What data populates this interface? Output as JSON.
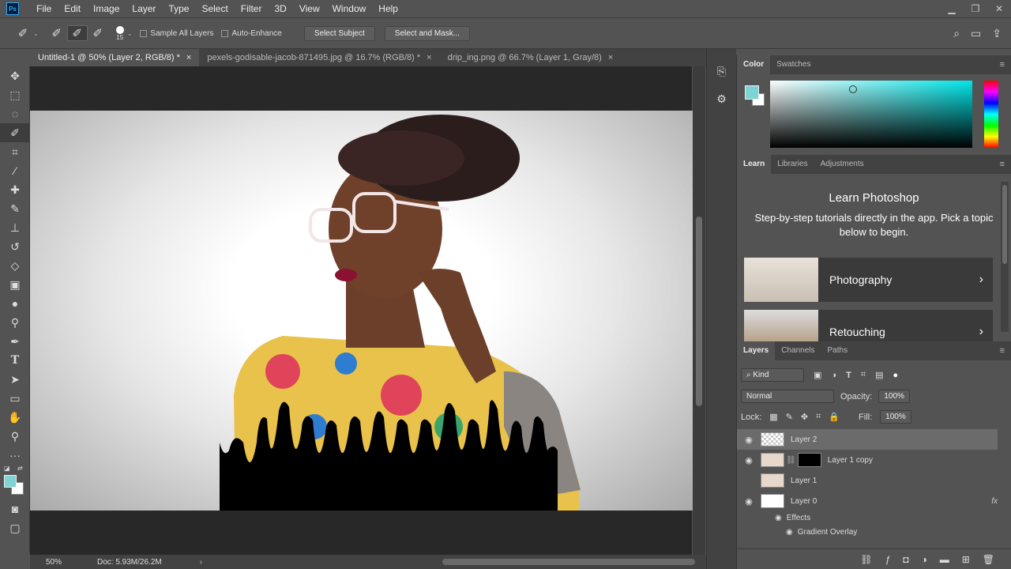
{
  "menu": {
    "logo": "Ps",
    "items": [
      "File",
      "Edit",
      "Image",
      "Layer",
      "Type",
      "Select",
      "Filter",
      "3D",
      "View",
      "Window",
      "Help"
    ]
  },
  "options": {
    "brush_size": "15",
    "sample_all_layers": "Sample All Layers",
    "auto_enhance": "Auto-Enhance",
    "select_subject": "Select Subject",
    "select_mask": "Select and Mask..."
  },
  "tabs": [
    {
      "label": "Untitled-1 @ 50% (Layer 2, RGB/8) *",
      "close": "×"
    },
    {
      "label": "pexels-godisable-jacob-871495.jpg @ 16.7% (RGB/8) *",
      "close": "×"
    },
    {
      "label": "drip_ing.png @ 66.7% (Layer 1, Gray/8)",
      "close": "×"
    }
  ],
  "status": {
    "zoom": "50%",
    "doc": "Doc: 5.93M/26.2M"
  },
  "color_panel": {
    "tabs": [
      "Color",
      "Swatches"
    ],
    "foreground": "#7fd3d6",
    "background": "#ffffff",
    "hue": "#00e5e8"
  },
  "learn_panel": {
    "tabs": [
      "Learn",
      "Libraries",
      "Adjustments"
    ],
    "title": "Learn Photoshop",
    "description": "Step-by-step tutorials directly in the app. Pick a topic below to begin.",
    "cards": [
      {
        "label": "Photography",
        "arrow": "›"
      },
      {
        "label": "Retouching",
        "arrow": "›"
      }
    ]
  },
  "layers_panel": {
    "tabs": [
      "Layers",
      "Channels",
      "Paths"
    ],
    "filter": "Kind",
    "blend_mode": "Normal",
    "opacity_label": "Opacity:",
    "opacity": "100%",
    "lock_label": "Lock:",
    "fill_label": "Fill:",
    "fill": "100%",
    "layers": [
      {
        "name": "Layer 2",
        "visible": true,
        "selected": true
      },
      {
        "name": "Layer 1 copy",
        "visible": true,
        "selected": false
      },
      {
        "name": "Layer 1",
        "visible": false,
        "selected": false
      },
      {
        "name": "Layer 0",
        "visible": true,
        "selected": false
      }
    ],
    "fx": "fx",
    "effects": "Effects",
    "gradient_overlay": "Gradient Overlay"
  }
}
